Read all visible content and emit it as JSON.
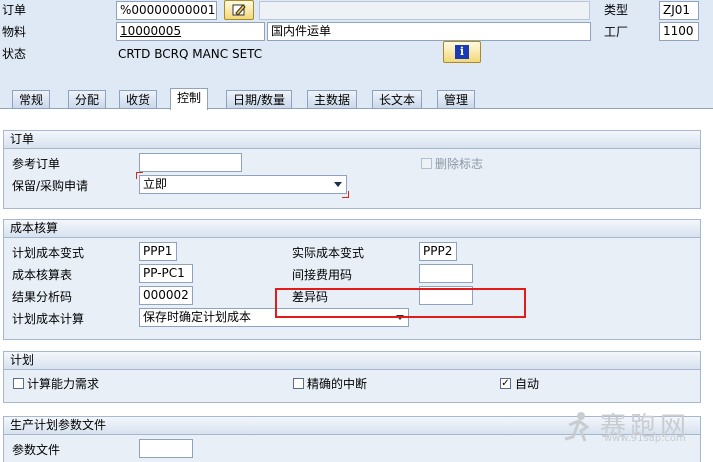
{
  "header": {
    "order_label": "订单",
    "order_value": "%00000000001",
    "material_label": "物料",
    "material_value": "10000005",
    "material_desc": "国内件运单",
    "status_label": "状态",
    "status_value": "CRTD BCRQ MANC SETC",
    "type_label": "类型",
    "type_value": "ZJ01",
    "plant_label": "工厂",
    "plant_value": "1100",
    "info_icon_glyph": "i"
  },
  "tabs": [
    {
      "label": "常规"
    },
    {
      "label": "分配"
    },
    {
      "label": "收货"
    },
    {
      "label": "控制",
      "active": true
    },
    {
      "label": "日期/数量"
    },
    {
      "label": "主数据"
    },
    {
      "label": "长文本"
    },
    {
      "label": "管理"
    }
  ],
  "order_group": {
    "title": "订单",
    "ref_order_label": "参考订单",
    "ref_order_value": "",
    "reservation_label": "保留/采购申请",
    "reservation_value": "立即",
    "delete_flag_label": "删除标志"
  },
  "costing_group": {
    "title": "成本核算",
    "planned_variant_label": "计划成本变式",
    "planned_variant_value": "PPP1",
    "actual_variant_label": "实际成本变式",
    "actual_variant_value": "PPP2",
    "costing_sheet_label": "成本核算表",
    "costing_sheet_value": "PP-PC1",
    "overhead_key_label": "间接费用码",
    "overhead_key_value": "",
    "ra_key_label": "结果分析码",
    "ra_key_value": "000002",
    "variance_key_label": "差异码",
    "variance_key_value": "",
    "planned_costing_label": "计划成本计算",
    "planned_costing_value": "保存时确定计划成本"
  },
  "planning_group": {
    "title": "计划",
    "capacity_label": "计算能力需求",
    "capacity_checked": false,
    "precise_label": "精确的中断",
    "precise_checked": false,
    "auto_label": "自动",
    "auto_checked": true,
    "check_mark": "✓"
  },
  "profile_group": {
    "title": "生产计划参数文件",
    "param_file_label": "参数文件",
    "param_file_value": ""
  },
  "watermark": {
    "text": "赛跑网",
    "url": "www.91sap.com"
  },
  "colors": {
    "highlight_red": "#e21b1b",
    "required_marker": "#d9261c"
  }
}
